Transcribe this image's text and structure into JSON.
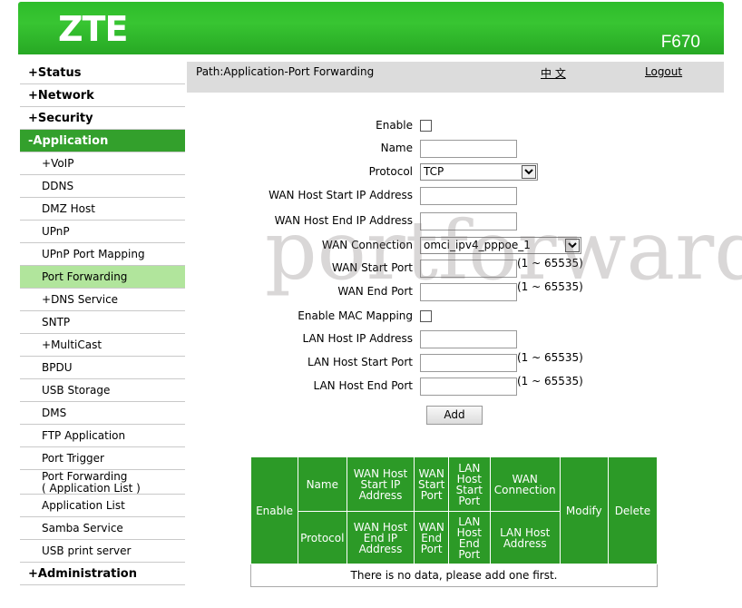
{
  "header": {
    "brand": "ZTE",
    "model": "F670"
  },
  "sidebar": {
    "items": [
      {
        "label": "Status",
        "prefix": "+"
      },
      {
        "label": "Network",
        "prefix": "+"
      },
      {
        "label": "Security",
        "prefix": "+"
      },
      {
        "label": "Application",
        "prefix": "-"
      },
      {
        "label": "VoIP",
        "prefix": "+"
      },
      {
        "label": "DDNS"
      },
      {
        "label": "DMZ Host"
      },
      {
        "label": "UPnP"
      },
      {
        "label": "UPnP Port Mapping"
      },
      {
        "label": "Port Forwarding"
      },
      {
        "label": "DNS Service",
        "prefix": "+"
      },
      {
        "label": "SNTP"
      },
      {
        "label": "MultiCast",
        "prefix": "+"
      },
      {
        "label": "BPDU"
      },
      {
        "label": "USB Storage"
      },
      {
        "label": "DMS"
      },
      {
        "label": "FTP Application"
      },
      {
        "label": "Port Trigger"
      },
      {
        "label": "Port Forwarding",
        "line2": "( Application List )"
      },
      {
        "label": "Application List"
      },
      {
        "label": "Samba Service"
      },
      {
        "label": "USB print server"
      },
      {
        "label": "Administration",
        "prefix": "+"
      }
    ]
  },
  "pathbar": {
    "path": "Path:Application-Port Forwarding",
    "language": "中 文",
    "logout": "Logout"
  },
  "watermark": "portforward",
  "form": {
    "enable_label": "Enable",
    "name_label": "Name",
    "protocol_label": "Protocol",
    "protocol_value": "TCP",
    "wan_host_start_ip_label": "WAN Host Start IP Address",
    "wan_host_end_ip_label": "WAN Host End IP Address",
    "wan_connection_label": "WAN Connection",
    "wan_connection_value": "omci_ipv4_pppoe_1",
    "wan_start_port_label": "WAN Start Port",
    "wan_end_port_label": "WAN End Port",
    "enable_mac_label": "Enable MAC Mapping",
    "lan_host_ip_label": "LAN Host IP Address",
    "lan_host_start_port_label": "LAN Host Start Port",
    "lan_host_end_port_label": "LAN Host End Port",
    "port_range_hint": "(1 ~ 65535)",
    "add_button": "Add"
  },
  "table": {
    "enable": "Enable",
    "name": "Name",
    "protocol": "Protocol",
    "wan_host_start_ip": "WAN Host Start IP Address",
    "wan_host_end_ip": "WAN Host End IP Address",
    "wan_start_port": "WAN Start Port",
    "wan_end_port": "WAN End Port",
    "lan_host_start_port": "LAN Host Start Port",
    "lan_host_end_port": "LAN Host End Port",
    "wan_connection": "WAN Connection",
    "lan_host_address": "LAN Host Address",
    "modify": "Modify",
    "delete": "Delete",
    "empty_message": "There is no data, please add one first."
  }
}
